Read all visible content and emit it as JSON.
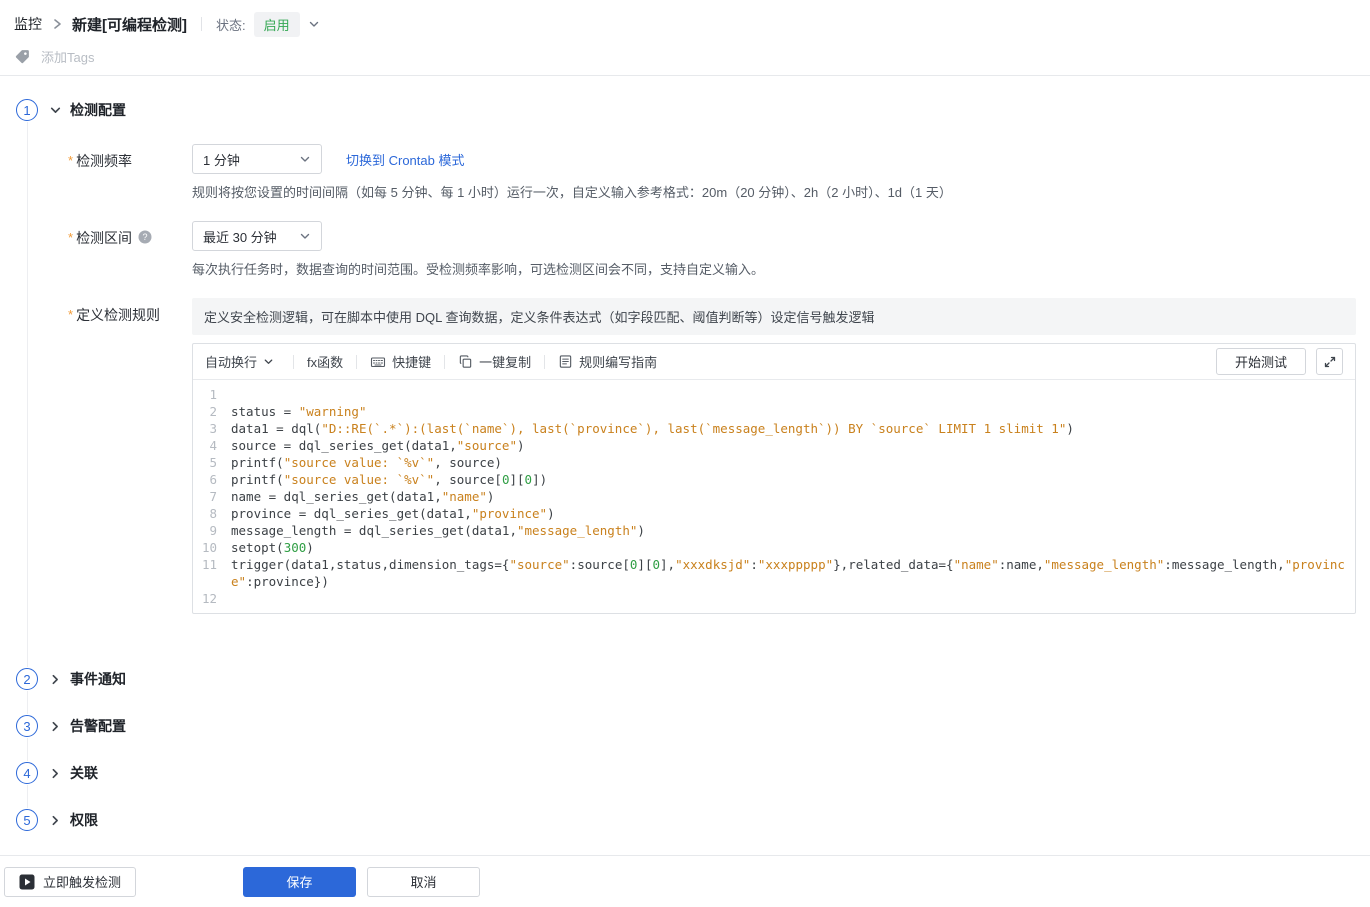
{
  "breadcrumb": {
    "root": "监控",
    "current": "新建[可编程检测]"
  },
  "status": {
    "label": "状态:",
    "value": "启用"
  },
  "tags": {
    "placeholder": "添加Tags"
  },
  "colors": {
    "accent_blue": "#2c68d9",
    "status_green": "#34a853",
    "asterisk_orange": "#f29b38",
    "code_string": "#c9811d",
    "code_number": "#2f9e44"
  },
  "section1": {
    "num": "1",
    "title": "检测配置",
    "frequency": {
      "label": "检测频率",
      "value": "1 分钟",
      "link": "切换到 Crontab 模式",
      "desc": "规则将按您设置的时间间隔（如每 5 分钟、每 1 小时）运行一次，自定义输入参考格式：20m（20 分钟）、2h（2 小时）、1d（1 天）"
    },
    "interval": {
      "label": "检测区间",
      "value": "最近 30 分钟",
      "desc": "每次执行任务时，数据查询的时间范围。受检测频率影响，可选检测区间会不同，支持自定义输入。"
    },
    "rule": {
      "label": "定义检测规则",
      "hint": "定义安全检测逻辑，可在脚本中使用 DQL 查询数据，定义条件表达式（如字段匹配、阈值判断等）设定信号触发逻辑"
    }
  },
  "editor": {
    "toolbar": {
      "wrap": "自动换行",
      "fx": "fx函数",
      "shortcut": "快捷键",
      "copy": "一键复制",
      "guide": "规则编写指南",
      "test": "开始测试"
    },
    "code_lines": [
      [],
      [
        [
          "",
          "status = "
        ],
        [
          "s",
          "\"warning\""
        ]
      ],
      [
        [
          "",
          "data1 = dql("
        ],
        [
          "s",
          "\"D::RE(`.*`):(last(`name`), last(`province`), last(`message_length`)) BY `source` LIMIT 1 slimit 1\""
        ],
        [
          "",
          ")"
        ]
      ],
      [
        [
          "",
          "source = dql_series_get(data1,"
        ],
        [
          "s",
          "\"source\""
        ],
        [
          "",
          ")"
        ]
      ],
      [
        [
          "",
          "printf("
        ],
        [
          "s",
          "\"source value: `%v`\""
        ],
        [
          "",
          ", source)"
        ]
      ],
      [
        [
          "",
          "printf("
        ],
        [
          "s",
          "\"source value: `%v`\""
        ],
        [
          "",
          ", source["
        ],
        [
          "n",
          "0"
        ],
        [
          "",
          "]["
        ],
        [
          "n",
          "0"
        ],
        [
          "",
          "])"
        ]
      ],
      [
        [
          "",
          "name = dql_series_get(data1,"
        ],
        [
          "s",
          "\"name\""
        ],
        [
          "",
          ")"
        ]
      ],
      [
        [
          "",
          "province = dql_series_get(data1,"
        ],
        [
          "s",
          "\"province\""
        ],
        [
          "",
          ")"
        ]
      ],
      [
        [
          "",
          "message_length = dql_series_get(data1,"
        ],
        [
          "s",
          "\"message_length\""
        ],
        [
          "",
          ")"
        ]
      ],
      [
        [
          "",
          "setopt("
        ],
        [
          "n",
          "300"
        ],
        [
          "",
          ")"
        ]
      ],
      [
        [
          "",
          "trigger(data1,status,dimension_tags={"
        ],
        [
          "s",
          "\"source\""
        ],
        [
          "",
          ":source["
        ],
        [
          "n",
          "0"
        ],
        [
          "",
          "]["
        ],
        [
          "n",
          "0"
        ],
        [
          "",
          "],"
        ],
        [
          "s",
          "\"xxxdksjd\""
        ],
        [
          "",
          ":"
        ],
        [
          "s",
          "\"xxxppppp\""
        ],
        [
          "",
          "},related_data={"
        ],
        [
          "s",
          "\"name\""
        ],
        [
          "",
          ":name,"
        ],
        [
          "s",
          "\"message_length\""
        ],
        [
          "",
          ":message_length,"
        ],
        [
          "s",
          "\"province\""
        ],
        [
          "",
          ":province})"
        ]
      ],
      []
    ]
  },
  "steps_collapsed": [
    {
      "num": "2",
      "title": "事件通知"
    },
    {
      "num": "3",
      "title": "告警配置"
    },
    {
      "num": "4",
      "title": "关联"
    },
    {
      "num": "5",
      "title": "权限"
    }
  ],
  "footer": {
    "trigger": "立即触发检测",
    "save": "保存",
    "cancel": "取消"
  }
}
